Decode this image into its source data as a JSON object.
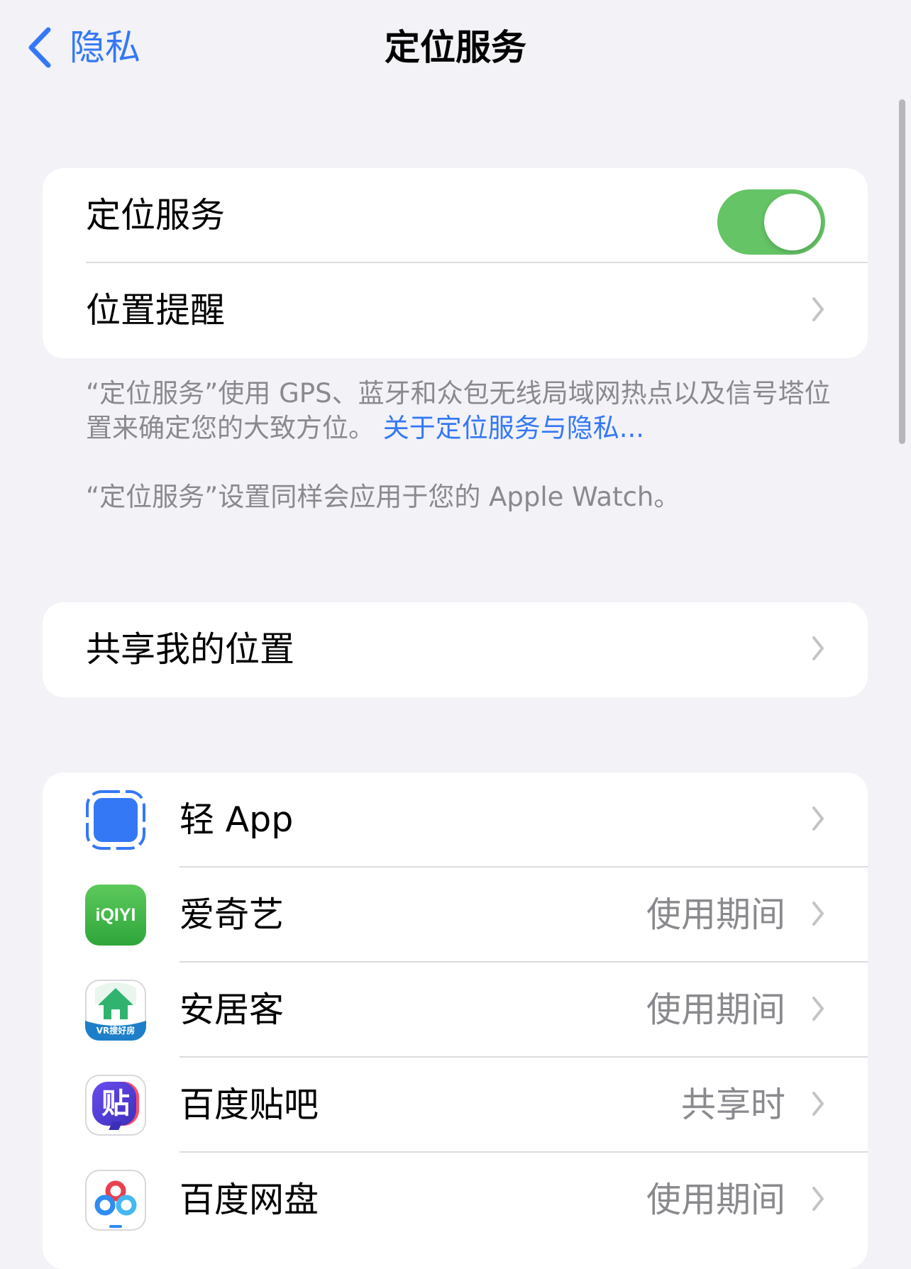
{
  "nav": {
    "back_label": "隐私",
    "title": "定位服务"
  },
  "main_section": {
    "location_services_label": "定位服务",
    "location_services_enabled": true,
    "location_alerts_label": "位置提醒"
  },
  "footnotes": {
    "description": "“定位服务”使用 GPS、蓝牙和众包无线局域网热点以及信号塔位置来确定您的大致方位。",
    "about_link": "关于定位服务与隐私...",
    "watch_note": "“定位服务”设置同样会应用于您的 Apple Watch。"
  },
  "share_section": {
    "share_label": "共享我的位置"
  },
  "apps": [
    {
      "name": "轻 App",
      "status": "",
      "icon": "app-clip-icon"
    },
    {
      "name": "爱奇艺",
      "status": "使用期间",
      "icon": "iqiyi-icon",
      "icon_text": "iQIYI"
    },
    {
      "name": "安居客",
      "status": "使用期间",
      "icon": "anjuke-icon",
      "icon_text": "VR搜好房"
    },
    {
      "name": "百度贴吧",
      "status": "共享时",
      "icon": "tieba-icon",
      "icon_text": "贴"
    },
    {
      "name": "百度网盘",
      "status": "使用期间",
      "icon": "baidu-netdisk-icon"
    }
  ],
  "colors": {
    "accent": "#3478f6",
    "toggle_on": "#65c466",
    "background": "#f2f2f7",
    "secondary_text": "#8a8a8e"
  }
}
